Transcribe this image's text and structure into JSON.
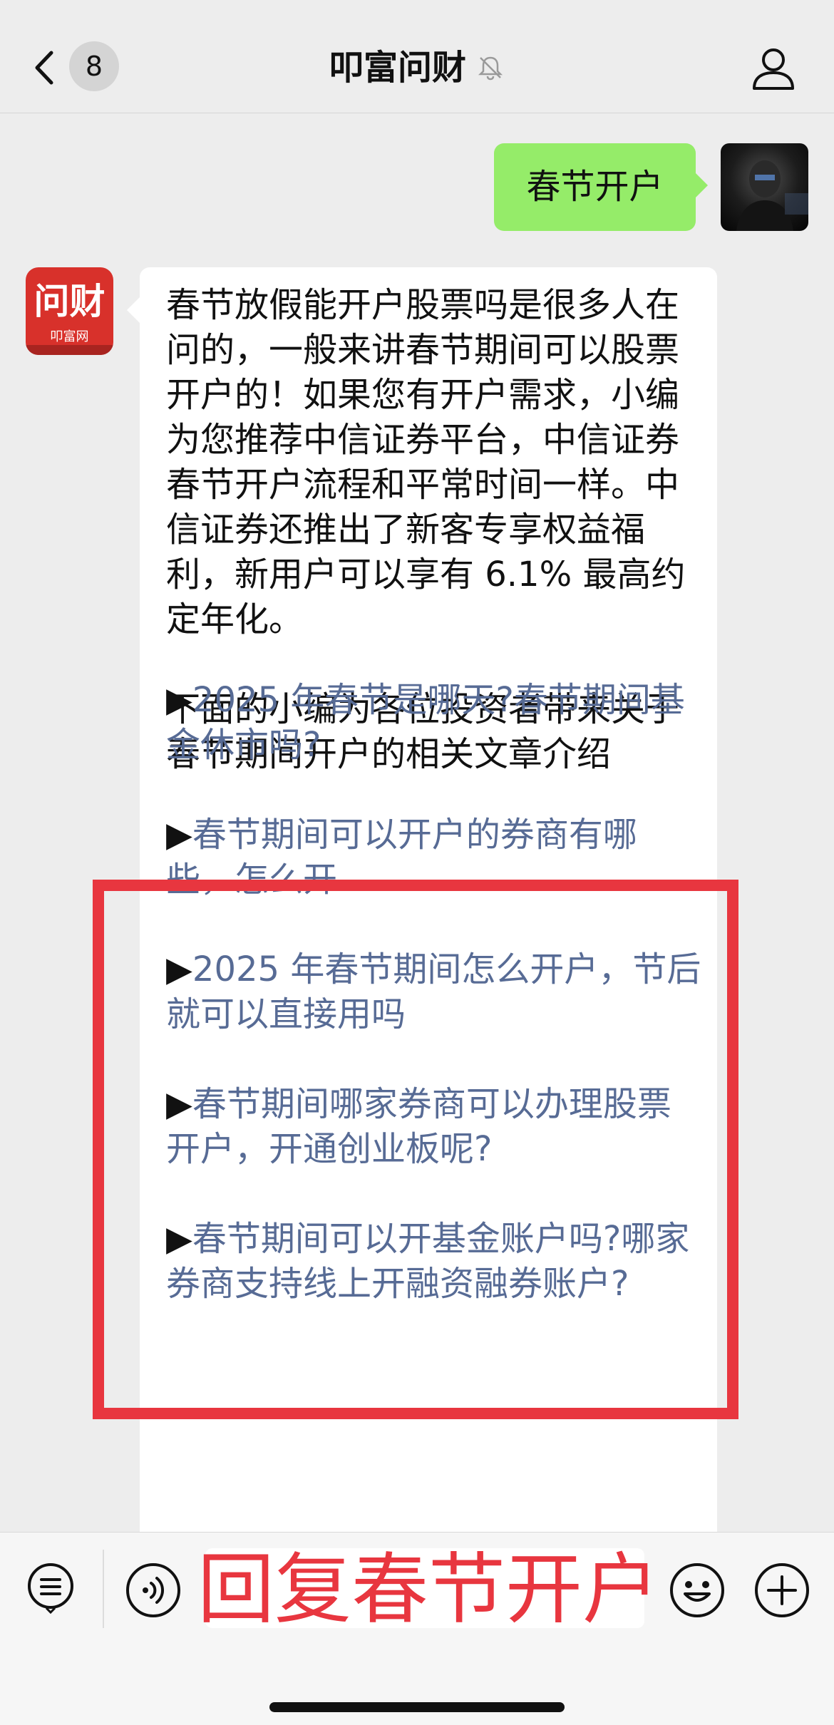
{
  "header": {
    "unread_count": "8",
    "title": "叩富问财",
    "back_icon": "chevron-left-icon",
    "mute_icon": "bell-off-icon",
    "profile_icon": "person-icon"
  },
  "messages": {
    "user_message": "春节开户",
    "bot_avatar": {
      "logo_main": "问财",
      "logo_sub": "叩富网"
    },
    "bot_paragraph_1": "春节放假能开户股票吗是很多人在问的，一般来讲春节期间可以股票开户的！如果您有开户需求，小编为您推荐中信证券平台，中信证券春节开户流程和平常时间一样。中信证券还推出了新客专享权益福利，新用户可以享有 6.1% 最高约定年化。",
    "bot_paragraph_2": "下面的小编为各位投资者带来关于春节期间开户的相关文章介绍",
    "link_arrow": "▶",
    "links": [
      {
        "label": "2025 年春节是哪天?春节期间基金休市吗?"
      },
      {
        "label": "春节期间可以开户的券商有哪些，怎么开"
      },
      {
        "label": "2025 年春节期间怎么开户，节后就可以直接用吗"
      },
      {
        "label": "春节期间哪家券商可以办理股票开户，开通创业板呢?"
      },
      {
        "label": "春节期间可以开基金账户吗?哪家券商支持线上开融资融券账户?"
      }
    ]
  },
  "input_bar": {
    "overlay_text": "回复春节开户",
    "menu_icon": "list-menu-icon",
    "voice_icon": "voice-icon",
    "emoji_icon": "smiley-icon",
    "plus_icon": "plus-icon"
  },
  "colors": {
    "accent_red": "#e8363f",
    "link_blue": "#576b95",
    "user_bubble_green": "#95ec69"
  }
}
